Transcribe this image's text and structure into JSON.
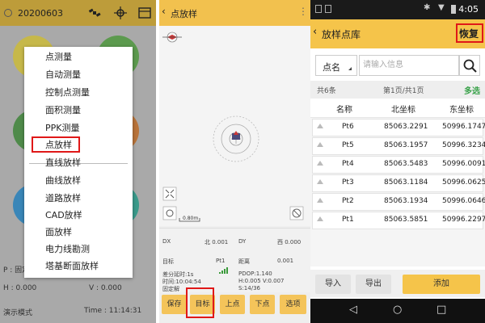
{
  "panel1": {
    "date": "20200603",
    "menu_items": [
      "点测量",
      "自动测量",
      "控制点测量",
      "面积测量",
      "PPK测量",
      "点放样",
      "直线放样",
      "曲线放样",
      "道路放样",
      "CAD放样",
      "面放样",
      "电力线勘测",
      "塔基断面放样"
    ],
    "info_p": "P : 固定",
    "info_h": "H : 0.000",
    "info_v": "V : 0.000",
    "mode": "演示模式",
    "time": "Time : 11:14:31",
    "colors": {
      "topbar": "#bd9c3a",
      "circle_yellow": "#d4c04a",
      "circle_green": "#5b9a52",
      "circle_red": "#b85a4a",
      "circle_blue": "#3c87b8",
      "circle_orange": "#c88a3a",
      "circle_teal": "#3a9a8a"
    }
  },
  "panel2": {
    "title": "点放样",
    "scale": "0.80m",
    "dx_label": "DX",
    "dx_value": "北 0.001",
    "dy_label": "DY",
    "dy_value": "西 0.000",
    "target_label": "目标",
    "target_value": "Pt1",
    "dist_label": "距离",
    "dist_value": "0.001",
    "diff_age": "差分延时:1s",
    "time": "时间:10:04:54",
    "solution": "固定解",
    "pdop": "PDOP:1.140",
    "hv": "H:0.005  V:0.007",
    "sats": "S:14/36",
    "buttons": [
      "保存",
      "目标",
      "上点",
      "下点",
      "选项"
    ],
    "colors": {
      "topbar": "#f2c14e",
      "button": "#f4c45a"
    }
  },
  "panel3": {
    "time": "4:05",
    "title": "放样点库",
    "restore": "恢复",
    "select_label": "点名",
    "search_placeholder": "请输入信息",
    "count": "共6条",
    "page": "第1页/共1页",
    "multi_select": "多选",
    "columns": [
      "名称",
      "北坐标",
      "东坐标"
    ],
    "rows": [
      {
        "name": "Pt6",
        "north": "85063.2291",
        "east": "50996.1747"
      },
      {
        "name": "Pt5",
        "north": "85063.1957",
        "east": "50996.3234"
      },
      {
        "name": "Pt4",
        "north": "85063.5483",
        "east": "50996.0091"
      },
      {
        "name": "Pt3",
        "north": "85063.1184",
        "east": "50996.0625"
      },
      {
        "name": "Pt2",
        "north": "85063.1934",
        "east": "50996.0646"
      },
      {
        "name": "Pt1",
        "north": "85063.5851",
        "east": "50996.2297"
      }
    ],
    "import": "导入",
    "export": "导出",
    "add": "添加",
    "colors": {
      "header": "#f5c44a",
      "add_button": "#f5c44a",
      "multi": "#39a24a"
    }
  }
}
